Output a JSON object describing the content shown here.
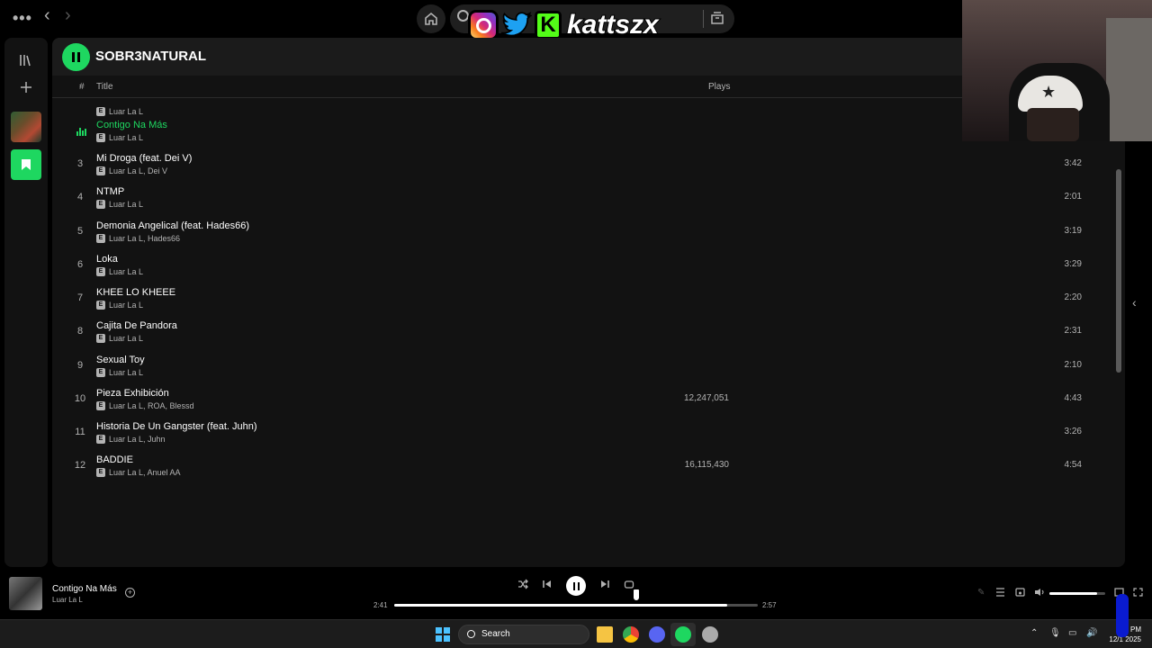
{
  "topbar": {
    "menu_label": "•••",
    "back_label": "‹",
    "forward_label": "›"
  },
  "overlay": {
    "streamer_handle": "kattszx",
    "kick_letter": "K"
  },
  "album": {
    "title": "SOBR3NATURAL"
  },
  "columns": {
    "number": "#",
    "title": "Title",
    "plays": "Plays"
  },
  "tracks": [
    {
      "num": "",
      "title": "",
      "artists": "Luar La L",
      "plays": "",
      "duration": ""
    },
    {
      "num": "",
      "title": "Contigo Na Más",
      "artists": "Luar La L",
      "plays": "",
      "duration": "",
      "active": true
    },
    {
      "num": "3",
      "title": "Mi Droga (feat. Dei V)",
      "artists": "Luar La L, Dei V",
      "plays": "",
      "duration": "3:42"
    },
    {
      "num": "4",
      "title": "NTMP",
      "artists": "Luar La L",
      "plays": "",
      "duration": "2:01"
    },
    {
      "num": "5",
      "title": "Demonia Angelical (feat. Hades66)",
      "artists": "Luar La L, Hades66",
      "plays": "",
      "duration": "3:19"
    },
    {
      "num": "6",
      "title": "Loka",
      "artists": "Luar La L",
      "plays": "",
      "duration": "3:29"
    },
    {
      "num": "7",
      "title": "KHEE LO KHEEE",
      "artists": "Luar La L",
      "plays": "",
      "duration": "2:20"
    },
    {
      "num": "8",
      "title": "Cajita De Pandora",
      "artists": "Luar La L",
      "plays": "",
      "duration": "2:31"
    },
    {
      "num": "9",
      "title": "Sexual Toy",
      "artists": "Luar La L",
      "plays": "",
      "duration": "2:10"
    },
    {
      "num": "10",
      "title": "Pieza Exhibición",
      "artists": "Luar La L, ROA, Blessd",
      "plays": "12,247,051",
      "duration": "4:43"
    },
    {
      "num": "11",
      "title": "Historia De Un Gangster (feat. Juhn)",
      "artists": "Luar La L, Juhn",
      "plays": "",
      "duration": "3:26"
    },
    {
      "num": "12",
      "title": "BADDIE",
      "artists": "Luar La L, Anuel AA",
      "plays": "16,115,430",
      "duration": "4:54"
    }
  ],
  "explicit_badge": "E",
  "now_playing": {
    "title": "Contigo Na Más",
    "artist": "Luar La L",
    "elapsed": "2:41",
    "total": "2:57",
    "progress_fraction": 0.915,
    "volume_fraction": 0.85
  },
  "taskbar": {
    "search_label": "Search",
    "time": "8 PM",
    "date": "12/1 2025"
  },
  "colors": {
    "accent": "#1ed760",
    "background": "#121212"
  }
}
